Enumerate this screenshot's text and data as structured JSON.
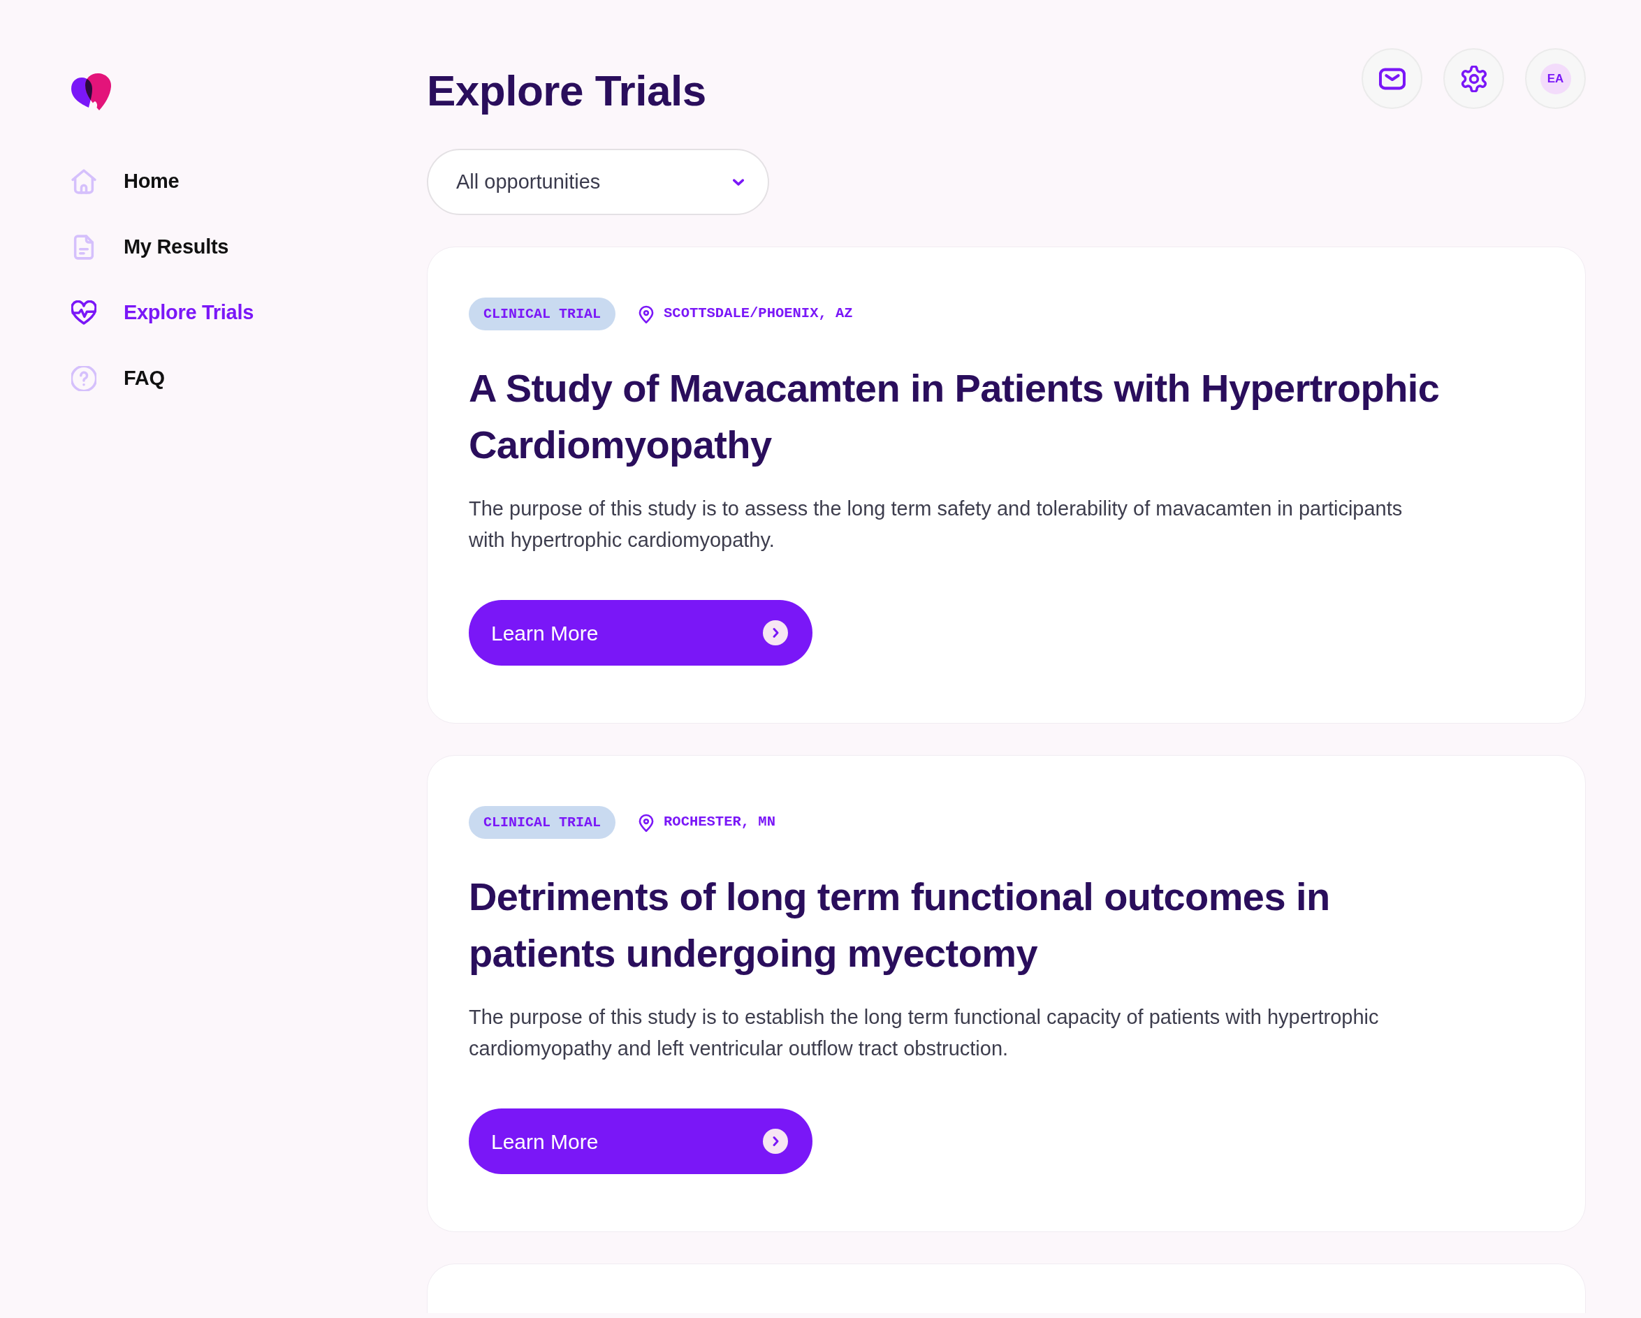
{
  "sidebar": {
    "items": [
      {
        "label": "Home",
        "selected": false
      },
      {
        "label": "My Results",
        "selected": false
      },
      {
        "label": "Explore Trials",
        "selected": true
      },
      {
        "label": "FAQ",
        "selected": false
      }
    ]
  },
  "header": {
    "title": "Explore Trials",
    "avatar_initials": "EA"
  },
  "filter": {
    "value": "All opportunities"
  },
  "trials": [
    {
      "tag": "CLINICAL TRIAL",
      "location": "SCOTTSDALE/PHOENIX, AZ",
      "title": "A Study of Mavacamten in Patients with Hypertrophic Cardiomyopathy",
      "description": "The purpose of this study is to assess the long term safety and tolerability of mavacamten in participants with hypertrophic cardiomyopathy.",
      "button": "Learn More"
    },
    {
      "tag": "CLINICAL TRIAL",
      "location": "ROCHESTER, MN",
      "title": "Detriments of long term functional outcomes in patients undergoing myectomy",
      "description": "The purpose of this study is to establish the long term functional capacity of patients with hypertrophic cardiomyopathy and left ventricular outflow tract obstruction.",
      "button": "Learn More"
    }
  ]
}
